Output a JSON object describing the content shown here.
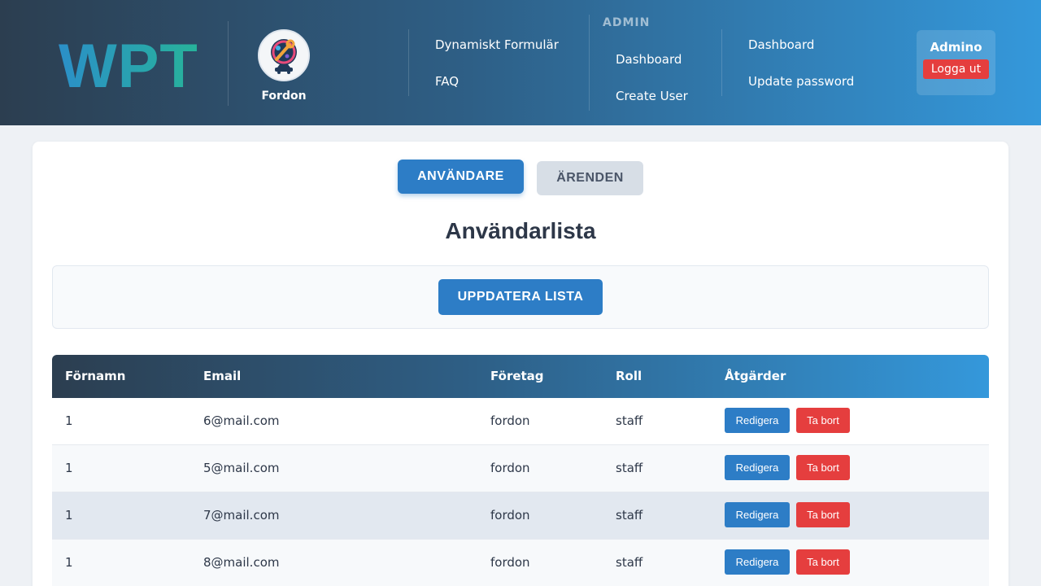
{
  "header": {
    "logo": "WPT",
    "brand_name": "Fordon",
    "nav": {
      "form_link": "Dynamiskt Formulär",
      "faq_link": "FAQ",
      "admin_heading": "ADMIN",
      "admin_dashboard": "Dashboard",
      "create_user": "Create User",
      "dashboard": "Dashboard",
      "update_password": "Update password"
    },
    "user": {
      "name": "Admino",
      "logout_label": "Logga ut"
    }
  },
  "tabs": {
    "users": "ANVÄNDARE",
    "cases": "ÄRENDEN"
  },
  "page_title": "Användarlista",
  "refresh_label": "UPPDATERA LISTA",
  "table": {
    "columns": [
      "Förnamn",
      "Email",
      "Företag",
      "Roll",
      "Åtgärder"
    ],
    "edit_label": "Redigera",
    "delete_label": "Ta bort",
    "rows": [
      {
        "first_name": "1",
        "email": "6@mail.com",
        "company": "fordon",
        "role": "staff"
      },
      {
        "first_name": "1",
        "email": "5@mail.com",
        "company": "fordon",
        "role": "staff"
      },
      {
        "first_name": "1",
        "email": "7@mail.com",
        "company": "fordon",
        "role": "staff"
      },
      {
        "first_name": "1",
        "email": "8@mail.com",
        "company": "fordon",
        "role": "staff"
      }
    ]
  },
  "colors": {
    "header_gradient_start": "#2c3e50",
    "header_gradient_end": "#3498db",
    "primary": "#2d7dc6",
    "danger": "#e53e3e",
    "row_alt": "#f7f9fb",
    "row_hover": "#e2e8f0"
  }
}
